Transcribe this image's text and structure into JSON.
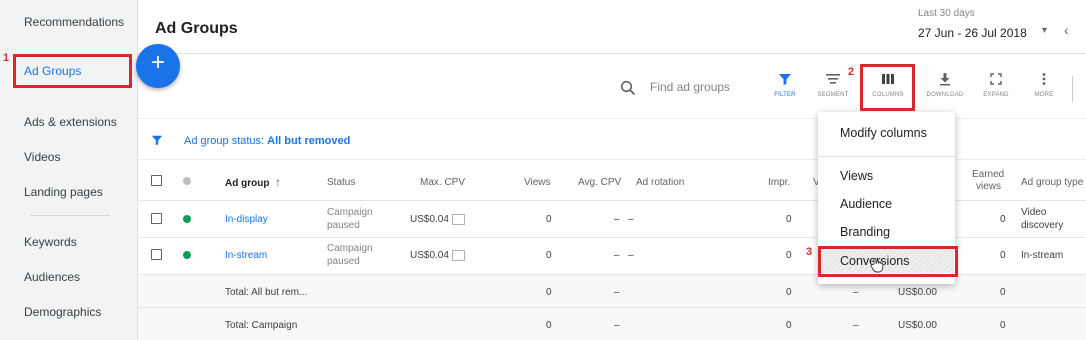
{
  "sidebar": {
    "items": [
      {
        "label": "Recommendations"
      },
      {
        "label": "Ad Groups"
      },
      {
        "label": "Ads & extensions"
      },
      {
        "label": "Videos"
      },
      {
        "label": "Landing pages"
      },
      {
        "label": "Keywords"
      },
      {
        "label": "Audiences"
      },
      {
        "label": "Demographics"
      }
    ]
  },
  "header": {
    "title": "Ad Groups",
    "date_label": "Last 30 days",
    "date_range": "27 Jun - 26 Jul 2018"
  },
  "fab": {
    "label": "+"
  },
  "toolbar": {
    "search_placeholder": "Find ad groups",
    "filter": "FILTER",
    "segment": "SEGMENT",
    "columns": "COLUMNS",
    "download": "DOWNLOAD",
    "expand": "EXPAND",
    "more": "MORE"
  },
  "filter_bar": {
    "prefix": "Ad group status:",
    "value": "All but removed"
  },
  "table": {
    "headers": {
      "ad_group": "Ad group",
      "status": "Status",
      "max_cpv": "Max. CPV",
      "views": "Views",
      "avg_cpv": "Avg. CPV",
      "ad_rotation": "Ad rotation",
      "impr": "Impr.",
      "v": "V",
      "earned_views_1": "Earned",
      "earned_views_2": "views",
      "ad_group_type": "Ad group type"
    },
    "rows": [
      {
        "name": "In-display",
        "status_1": "Campaign",
        "status_2": "paused",
        "max_cpv": "US$0.04",
        "views": "0",
        "avg_cpv": "–",
        "ad_rotation": "–",
        "impr": "0",
        "earned_views": "0",
        "type_1": "Video",
        "type_2": "discovery",
        "status_color": "#0f9d58"
      },
      {
        "name": "In-stream",
        "status_1": "Campaign",
        "status_2": "paused",
        "max_cpv": "US$0.04",
        "views": "0",
        "avg_cpv": "–",
        "ad_rotation": "–",
        "impr": "0",
        "earned_views": "0",
        "type_1": "In-stream",
        "status_color": "#0f9d58"
      }
    ],
    "totals": [
      {
        "label": "Total: All but rem...",
        "views": "0",
        "avg_cpv": "–",
        "impr": "0",
        "dash": "–",
        "cost": "US$0.00",
        "earned_views": "0"
      },
      {
        "label": "Total: Campaign",
        "views": "0",
        "avg_cpv": "–",
        "impr": "0",
        "dash": "–",
        "cost": "US$0.00",
        "earned_views": "0"
      }
    ]
  },
  "columns_menu": {
    "modify": "Modify columns",
    "views": "Views",
    "audience": "Audience",
    "branding": "Branding",
    "conversions": "Conversions"
  },
  "annotations": {
    "step1": "1",
    "step2": "2",
    "step3": "3"
  },
  "colors": {
    "accent": "#1a73e8",
    "highlight": "#d8282b",
    "enabled_dot": "#0f9d58"
  }
}
